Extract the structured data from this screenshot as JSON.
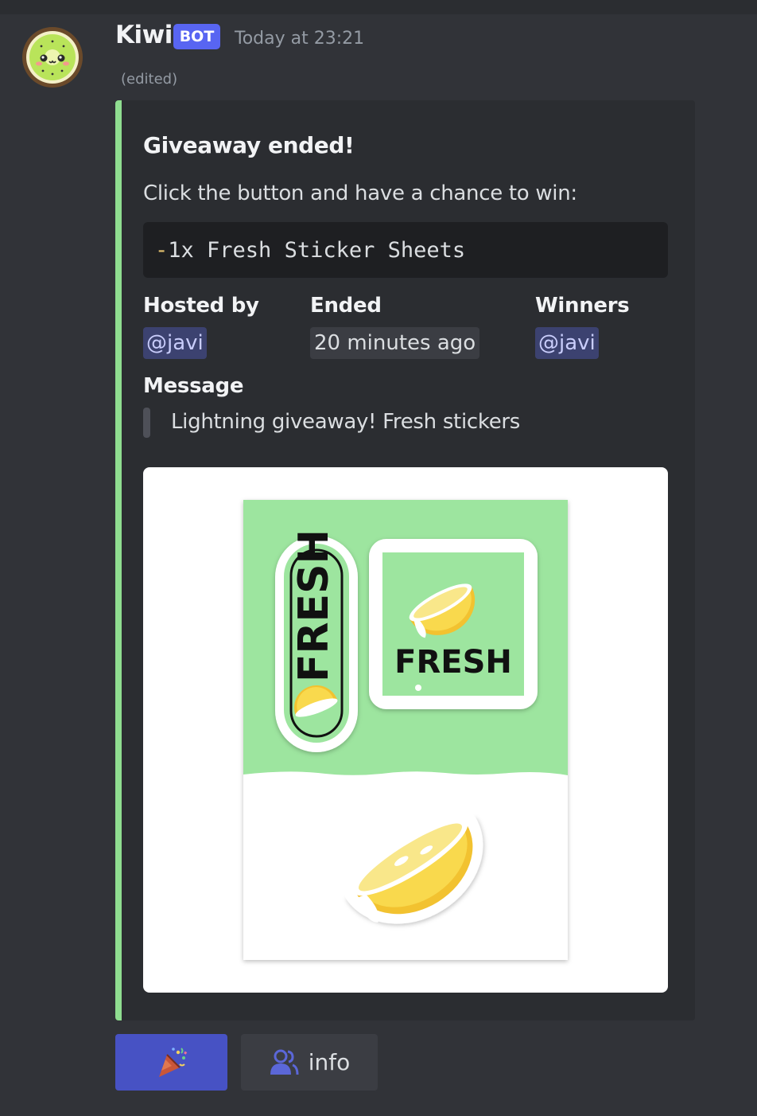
{
  "message": {
    "author": "Kiwi",
    "badge": "BOT",
    "timestamp": "Today at 23:21",
    "edited": "(edited)"
  },
  "embed": {
    "accent_color": "#8fdd90",
    "title": "Giveaway ended!",
    "description": "Click the button and have a chance to win:",
    "prize_dash": "-",
    "prize_line": "1x Fresh Sticker Sheets",
    "fields": {
      "hosted_by": {
        "name": "Hosted by",
        "value": "@javi"
      },
      "ended": {
        "name": "Ended",
        "value": "20 minutes ago"
      },
      "winners": {
        "name": "Winners",
        "value": "@javi"
      }
    },
    "message_field": {
      "name": "Message",
      "value": "Lightning giveaway! Fresh stickers"
    },
    "image": {
      "sticker_text_vertical": "FRESH",
      "sticker_text_square": "FRESH"
    }
  },
  "buttons": {
    "enter": {
      "icon": "party-popper-icon"
    },
    "info": {
      "icon": "people-icon",
      "label": "info"
    }
  },
  "colors": {
    "background": "#313338",
    "embed_bg": "#2b2d31",
    "blurple": "#5865f2",
    "mention_bg": "#3c4270",
    "sticker_green": "#9de59f",
    "lemon_yellow": "#f9d94d"
  }
}
